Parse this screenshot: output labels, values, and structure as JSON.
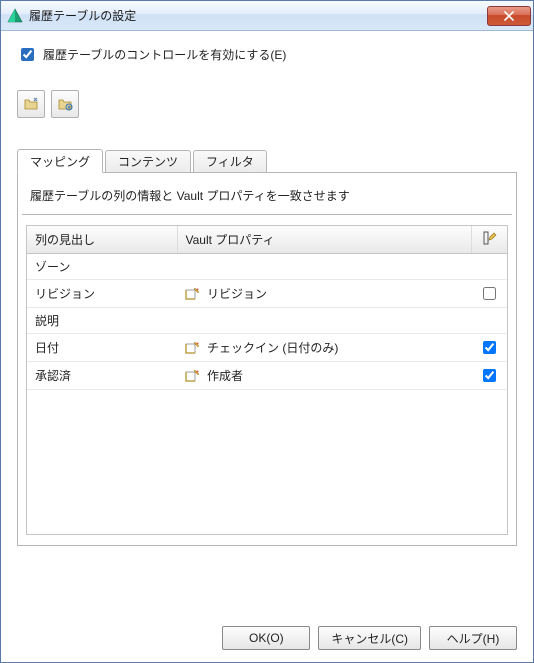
{
  "window": {
    "title": "履歴テーブルの設定"
  },
  "enable_checkbox": {
    "label": "履歴テーブルのコントロールを有効にする(E)",
    "checked": true
  },
  "tabs": {
    "active_index": 0,
    "items": [
      {
        "label": "マッピング"
      },
      {
        "label": "コンテンツ"
      },
      {
        "label": "フィルタ"
      }
    ]
  },
  "mapping_panel": {
    "description": "履歴テーブルの列の情報と Vault プロパティを一致させます",
    "columns": {
      "col1": "列の見出し",
      "col2": "Vault プロパティ",
      "col3_icon": "edit-column"
    },
    "rows": [
      {
        "heading": "ゾーン",
        "vault_property": "",
        "has_vault_icon": false,
        "flag": null
      },
      {
        "heading": "リビジョン",
        "vault_property": "リビジョン",
        "has_vault_icon": true,
        "flag": false
      },
      {
        "heading": "説明",
        "vault_property": "",
        "has_vault_icon": false,
        "flag": null
      },
      {
        "heading": "日付",
        "vault_property": "チェックイン (日付のみ)",
        "has_vault_icon": true,
        "flag": true
      },
      {
        "heading": "承認済",
        "vault_property": "作成者",
        "has_vault_icon": true,
        "flag": true
      }
    ]
  },
  "buttons": {
    "ok": "OK(O)",
    "cancel": "キャンセル(C)",
    "help": "ヘルプ(H)"
  }
}
